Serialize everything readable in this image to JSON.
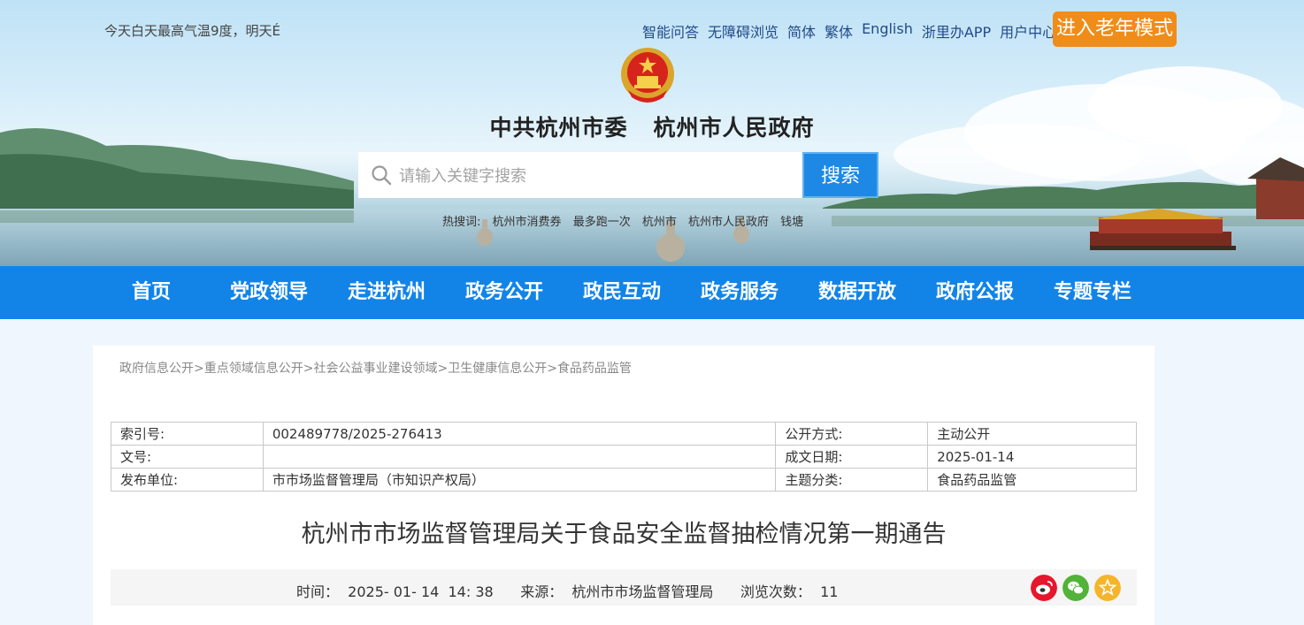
{
  "header": {
    "weather": "今天白天最高气温9度，明天É",
    "toplinks": [
      "智能问答",
      "无障碍浏览",
      "简体",
      "繁体",
      "English",
      "浙里办APP",
      "用户中心"
    ],
    "elder_mode": "进入老年模式",
    "site_title": "中共杭州市委   杭州市人民政府",
    "search": {
      "placeholder": "请输入关键字搜索",
      "button": "搜索"
    },
    "hotwords": [
      "热搜词:",
      "杭州市消费券",
      "最多跑一次",
      "杭州市",
      "杭州市人民政府",
      "钱塘"
    ]
  },
  "nav": [
    "首页",
    "党政领导",
    "走进杭州",
    "政务公开",
    "政民互动",
    "政务服务",
    "数据开放",
    "政府公报",
    "专题专栏"
  ],
  "breadcrumb": [
    "政府信息公开",
    "重点领域信息公开",
    "社会公益事业建设领域",
    "卫生健康信息公开",
    "食品药品监管"
  ],
  "meta": {
    "index_label": "索引号:",
    "index_value": "002489778/2025-276413",
    "open_label": "公开方式:",
    "open_value": "主动公开",
    "docno_label": "文号:",
    "docno_value": "",
    "date_label": "成文日期:",
    "date_value": "2025-01-14",
    "publisher_label": "发布单位:",
    "publisher_value": "市市场监督管理局（市知识产权局）",
    "topic_label": "主题分类:",
    "topic_value": "食品药品监管"
  },
  "article": {
    "title": "杭州市市场监督管理局关于食品安全监督抽检情况第一期通告",
    "info": "时间：  2025- 01- 14  14: 38      来源：  杭州市市场监督管理局      浏览次数：  11"
  },
  "share": {
    "icons": [
      "weibo-icon",
      "wechat-icon",
      "favorite-icon"
    ],
    "colors": [
      "#e6162d",
      "#51b337",
      "#f5b52a"
    ]
  },
  "colors": {
    "nav_bg": "#1284e8",
    "elder_btn": "#f08c19",
    "search_btn": "#1e88e5"
  }
}
